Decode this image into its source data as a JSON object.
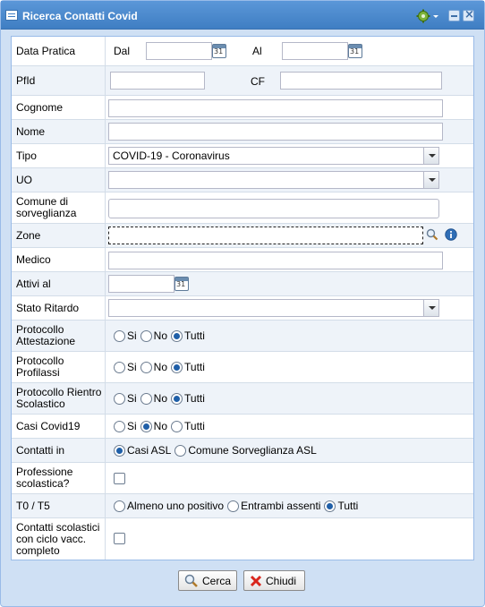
{
  "window": {
    "title": "Ricerca Contatti Covid"
  },
  "fields": {
    "data_pratica": {
      "label": "Data Pratica",
      "dal_label": "Dal",
      "al_label": "Al",
      "dal_value": "",
      "al_value": ""
    },
    "pfid": {
      "label": "PfId",
      "value": "",
      "cf_label": "CF",
      "cf_value": ""
    },
    "cognome": {
      "label": "Cognome",
      "value": ""
    },
    "nome": {
      "label": "Nome",
      "value": ""
    },
    "tipo": {
      "label": "Tipo",
      "value": "COVID-19 - Coronavirus"
    },
    "uo": {
      "label": "UO",
      "value": ""
    },
    "comune": {
      "label": "Comune di sorveglianza",
      "value": ""
    },
    "zone": {
      "label": "Zone",
      "value": ""
    },
    "medico": {
      "label": "Medico",
      "value": ""
    },
    "attivi_al": {
      "label": "Attivi al",
      "value": ""
    },
    "stato_ritardo": {
      "label": "Stato Ritardo",
      "value": ""
    },
    "protocollo_attestazione": {
      "label": "Protocollo Attestazione",
      "options": [
        "Si",
        "No",
        "Tutti"
      ],
      "selected": "Tutti"
    },
    "protocollo_profilassi": {
      "label": "Protocollo Profilassi",
      "options": [
        "Si",
        "No",
        "Tutti"
      ],
      "selected": "Tutti"
    },
    "protocollo_rientro": {
      "label": "Protocollo Rientro Scolastico",
      "options": [
        "Si",
        "No",
        "Tutti"
      ],
      "selected": "Tutti"
    },
    "casi_covid": {
      "label": "Casi Covid19",
      "options": [
        "Si",
        "No",
        "Tutti"
      ],
      "selected": "No"
    },
    "contatti_in": {
      "label": "Contatti in",
      "options": [
        "Casi ASL",
        "Comune Sorveglianza ASL"
      ],
      "selected": "Casi ASL"
    },
    "professione_scolastica": {
      "label": "Professione scolastica?",
      "checked": false
    },
    "t0_t5": {
      "label": "T0 / T5",
      "options": [
        "Almeno uno positivo",
        "Entrambi assenti",
        "Tutti"
      ],
      "selected": "Tutti"
    },
    "contatti_scolastici": {
      "label": "Contatti scolastici con ciclo vacc. completo",
      "checked": false
    }
  },
  "buttons": {
    "cerca": "Cerca",
    "chiudi": "Chiudi"
  },
  "icons": {
    "calendar_glyph": "31",
    "colors": {
      "title_bar": "#4a88cc",
      "radio_selected": "#1f5fa8",
      "chiudi_icon": "#d9261c"
    }
  }
}
